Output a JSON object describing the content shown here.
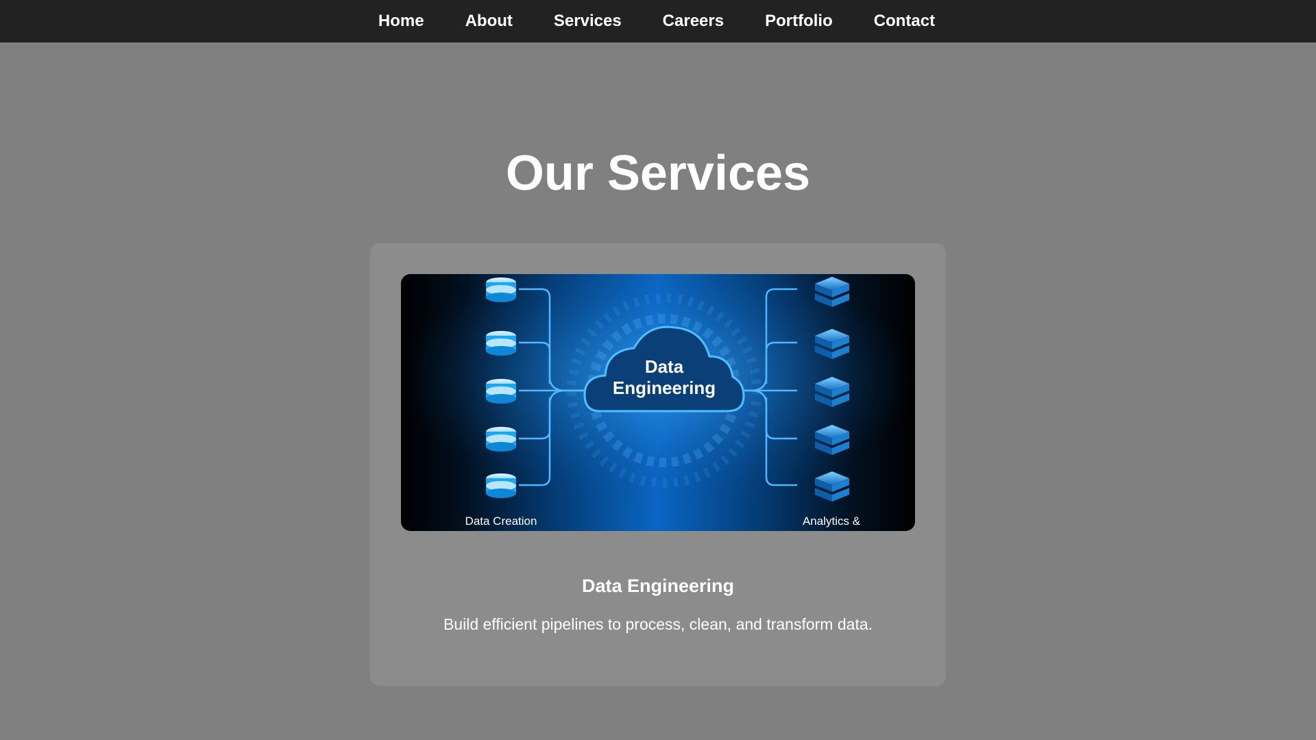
{
  "nav": {
    "items": [
      {
        "label": "Home"
      },
      {
        "label": "About"
      },
      {
        "label": "Services"
      },
      {
        "label": "Careers"
      },
      {
        "label": "Portfolio"
      },
      {
        "label": "Contact"
      }
    ]
  },
  "page": {
    "title": "Our Services"
  },
  "service_card": {
    "image": {
      "center_line1": "Data",
      "center_line2": "Engineering",
      "left_caption": "Data Creation",
      "right_caption": "Analytics &"
    },
    "title": "Data Engineering",
    "description": "Build efficient pipelines to process, clean, and transform data."
  },
  "colors": {
    "navbar_bg": "#222222",
    "page_bg": "#808080",
    "card_bg": "#8c8c8c",
    "accent_blue": "#1a8fe0"
  }
}
